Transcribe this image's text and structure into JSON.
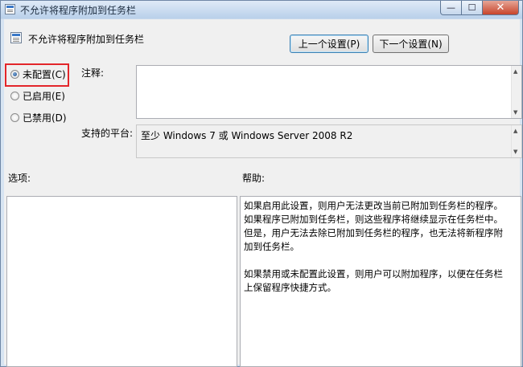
{
  "window": {
    "title": "不允许将程序附加到任务栏",
    "minimize": "—",
    "maximize": "☐",
    "close": "✕"
  },
  "policy": {
    "name": "不允许将程序附加到任务栏",
    "prev_button": "上一个设置(P)",
    "next_button": "下一个设置(N)"
  },
  "state": {
    "options": [
      {
        "label": "未配置(C)",
        "selected": true
      },
      {
        "label": "已启用(E)",
        "selected": false
      },
      {
        "label": "已禁用(D)",
        "selected": false
      }
    ]
  },
  "comment": {
    "label": "注释:",
    "value": ""
  },
  "platform": {
    "label": "支持的平台:",
    "value": "至少 Windows 7 或 Windows Server 2008 R2"
  },
  "options_pane": {
    "label": "选项:"
  },
  "help_pane": {
    "label": "帮助:",
    "text": "如果启用此设置，则用户无法更改当前已附加到任务栏的程序。如果程序已附加到任务栏，则这些程序将继续显示在任务栏中。但是，用户无法去除已附加到任务栏的程序，也无法将新程序附加到任务栏。\n\n如果禁用或未配置此设置，则用户可以附加程序，以便在任务栏上保留程序快捷方式。"
  }
}
